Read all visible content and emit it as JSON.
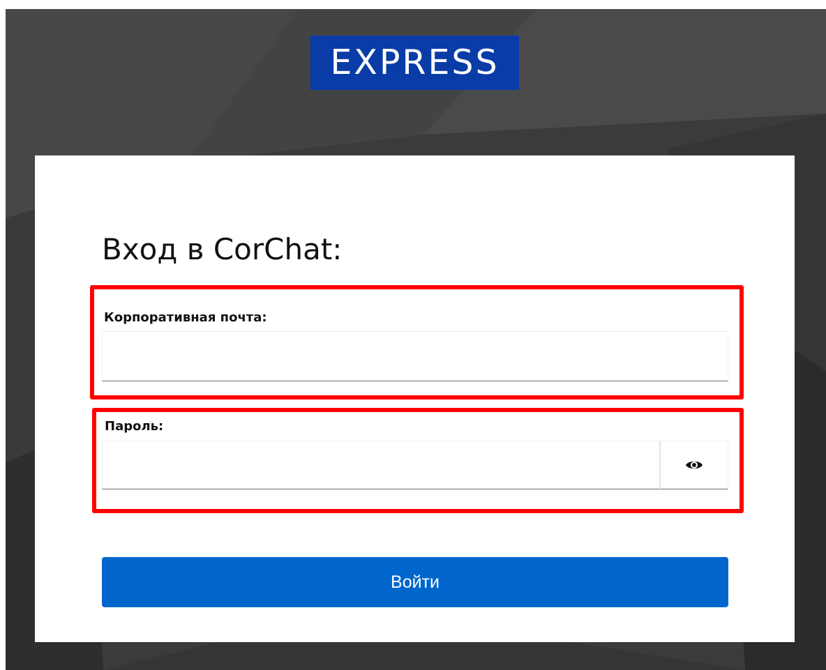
{
  "logo": {
    "text": "EXPRESS",
    "background": "#0a3ca8"
  },
  "login": {
    "title": "Вход в CorChat:",
    "email": {
      "label": "Корпоративная почта:",
      "value": "",
      "placeholder": ""
    },
    "password": {
      "label": "Пароль:",
      "value": "",
      "placeholder": "",
      "toggle_icon": "eye-icon"
    },
    "submit_label": "Войти"
  },
  "colors": {
    "accent": "#0066cc",
    "highlight": "#ff0000",
    "backdrop": "#3b3b3b"
  }
}
